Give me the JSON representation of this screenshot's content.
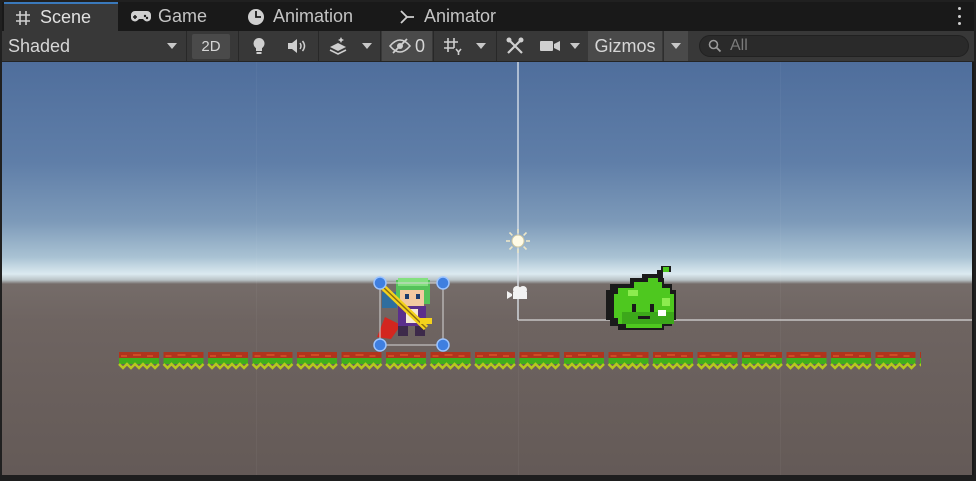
{
  "tabs": [
    {
      "label": "Scene",
      "icon": "grid-hash-icon",
      "active": true
    },
    {
      "label": "Game",
      "icon": "gamepad-icon",
      "active": false
    },
    {
      "label": "Animation",
      "icon": "clock-icon",
      "active": false
    },
    {
      "label": "Animator",
      "icon": "animator-icon",
      "active": false
    }
  ],
  "toolbar": {
    "draw_mode": "Shaded",
    "mode_2d": "2D",
    "hidden_count": "0",
    "gizmos_label": "Gizmos",
    "search_placeholder": "All"
  },
  "colors": {
    "accent": "#3a79bb",
    "handle": "#3f7fe0",
    "slime": "#4ec81f",
    "grass": "#3fae1c",
    "soil": "#b0341c"
  }
}
